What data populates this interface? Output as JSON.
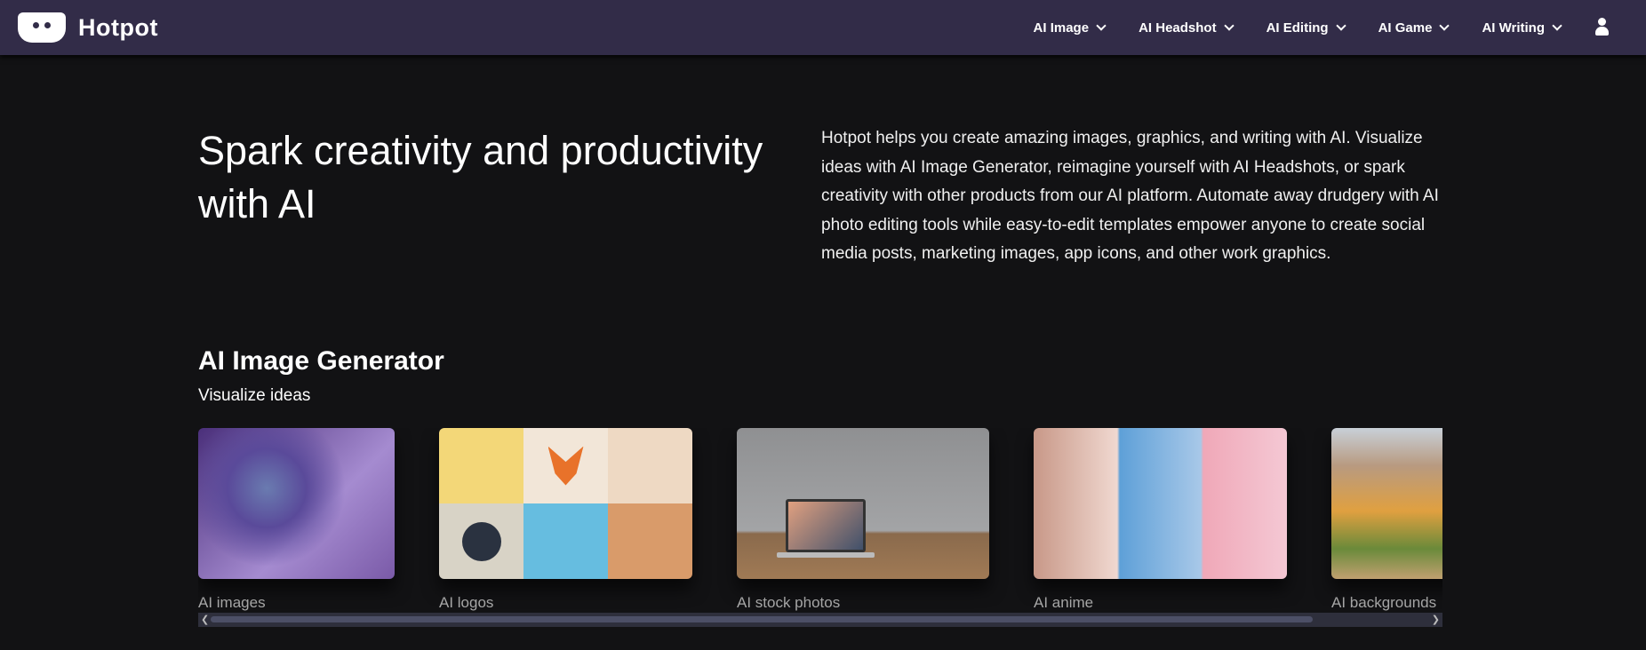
{
  "nav": {
    "brand": "Hotpot",
    "items": [
      {
        "label": "AI Image"
      },
      {
        "label": "AI Headshot"
      },
      {
        "label": "AI Editing"
      },
      {
        "label": "AI Game"
      },
      {
        "label": "AI Writing"
      }
    ],
    "user_icon": "user-icon"
  },
  "hero": {
    "title": "Spark creativity and productivity with AI",
    "text": "Hotpot helps you create amazing images, graphics, and writing with AI. Visualize ideas with AI Image Generator, reimagine yourself with AI Headshots, or spark creativity with other products from our AI platform. Automate away drudgery with AI photo editing tools while easy-to-edit templates empower anyone to create social media posts, marketing images, app icons, and other work graphics."
  },
  "section": {
    "title": "AI Image Generator",
    "subtitle": "Visualize ideas",
    "cards": [
      {
        "label": "AI images"
      },
      {
        "label": "AI logos"
      },
      {
        "label": "AI stock photos"
      },
      {
        "label": "AI anime"
      },
      {
        "label": "AI backgrounds"
      }
    ]
  },
  "colors": {
    "nav_bg": "#322c48",
    "page_bg": "#121214"
  }
}
